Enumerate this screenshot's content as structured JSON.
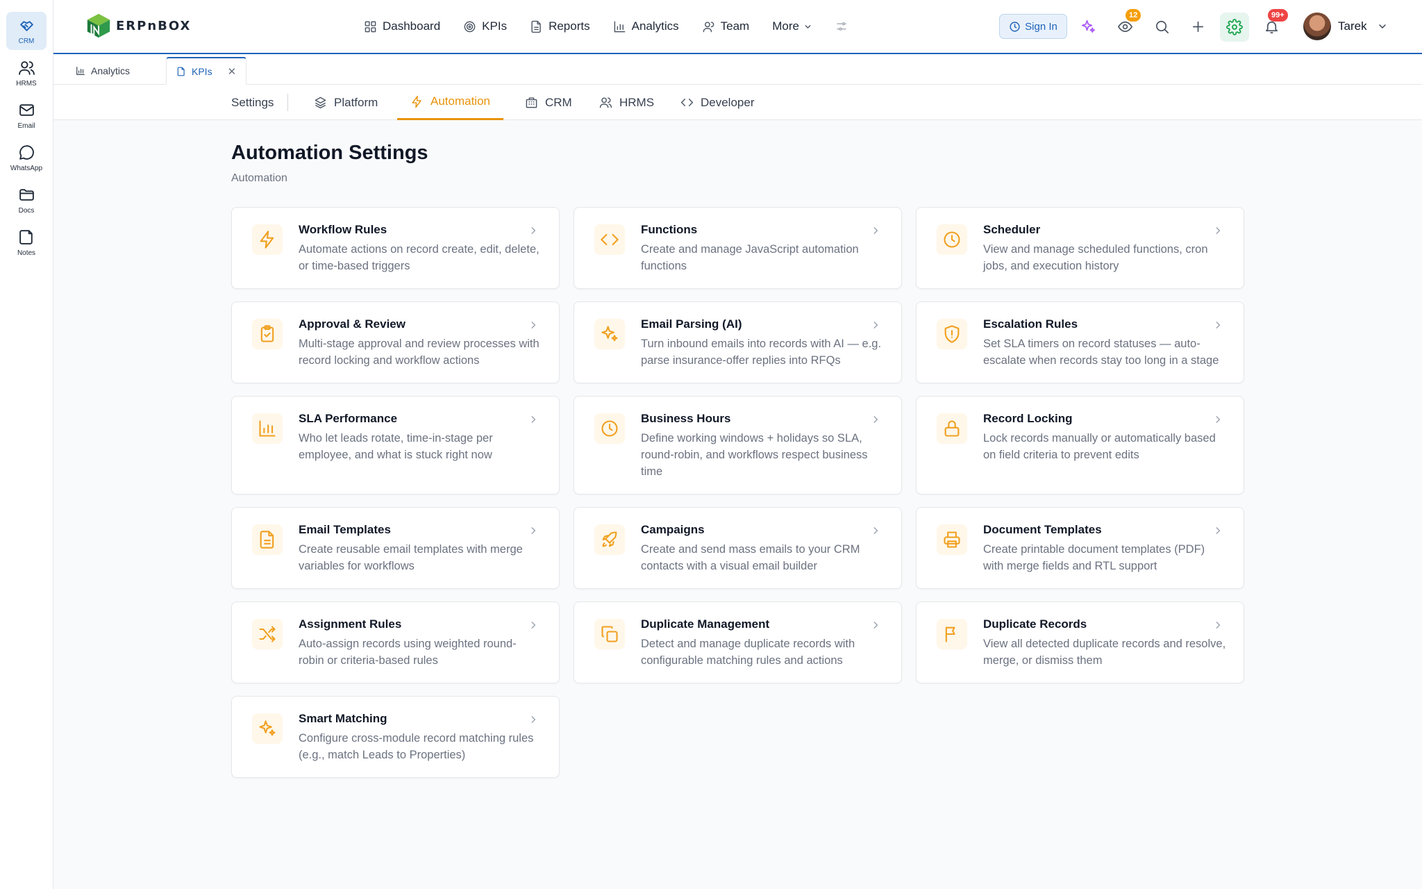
{
  "rail": [
    {
      "label": "CRM",
      "icon": "handshake-icon",
      "active": true
    },
    {
      "label": "HRMS",
      "icon": "users-icon"
    },
    {
      "label": "Email",
      "icon": "mail-icon"
    },
    {
      "label": "WhatsApp",
      "icon": "chat-icon"
    },
    {
      "label": "Docs",
      "icon": "folder-icon"
    },
    {
      "label": "Notes",
      "icon": "note-icon"
    }
  ],
  "brand": {
    "name": "ERPnBOX"
  },
  "nav": {
    "dashboard": "Dashboard",
    "kpis": "KPIs",
    "reports": "Reports",
    "analytics": "Analytics",
    "team": "Team",
    "more": "More"
  },
  "header": {
    "sign_in": "Sign In",
    "watch_badge": "12",
    "notif_badge": "99+",
    "user_name": "Tarek"
  },
  "page_tabs": [
    {
      "label": "Analytics",
      "icon": "bar-chart-icon"
    },
    {
      "label": "KPIs",
      "icon": "file-icon",
      "active": true
    }
  ],
  "subnav": {
    "settings": "Settings",
    "tabs": [
      {
        "label": "Platform",
        "icon": "layers-icon"
      },
      {
        "label": "Automation",
        "icon": "bolt-icon",
        "active": true
      },
      {
        "label": "CRM",
        "icon": "building-icon"
      },
      {
        "label": "HRMS",
        "icon": "users-icon"
      },
      {
        "label": "Developer",
        "icon": "code-icon"
      }
    ]
  },
  "page": {
    "title": "Automation Settings",
    "subtitle": "Automation"
  },
  "cards": [
    {
      "title": "Workflow Rules",
      "desc": "Automate actions on record create, edit, delete, or time-based triggers",
      "icon": "bolt-icon"
    },
    {
      "title": "Functions",
      "desc": "Create and manage JavaScript automation functions",
      "icon": "code-icon"
    },
    {
      "title": "Scheduler",
      "desc": "View and manage scheduled functions, cron jobs, and execution history",
      "icon": "clock-icon"
    },
    {
      "title": "Approval & Review",
      "desc": "Multi-stage approval and review processes with record locking and workflow actions",
      "icon": "clipboard-check-icon"
    },
    {
      "title": "Email Parsing (AI)",
      "desc": "Turn inbound emails into records with AI — e.g. parse insurance-offer replies into RFQs",
      "icon": "sparkles-icon"
    },
    {
      "title": "Escalation Rules",
      "desc": "Set SLA timers on record statuses — auto-escalate when records stay too long in a stage",
      "icon": "shield-alert-icon"
    },
    {
      "title": "SLA Performance",
      "desc": "Who let leads rotate, time-in-stage per employee, and what is stuck right now",
      "icon": "bar-chart-icon"
    },
    {
      "title": "Business Hours",
      "desc": "Define working windows + holidays so SLA, round-robin, and workflows respect business time",
      "icon": "clock-icon"
    },
    {
      "title": "Record Locking",
      "desc": "Lock records manually or automatically based on field criteria to prevent edits",
      "icon": "lock-icon"
    },
    {
      "title": "Email Templates",
      "desc": "Create reusable email templates with merge variables for workflows",
      "icon": "file-text-icon"
    },
    {
      "title": "Campaigns",
      "desc": "Create and send mass emails to your CRM contacts with a visual email builder",
      "icon": "rocket-icon"
    },
    {
      "title": "Document Templates",
      "desc": "Create printable document templates (PDF) with merge fields and RTL support",
      "icon": "printer-icon"
    },
    {
      "title": "Assignment Rules",
      "desc": "Auto-assign records using weighted round-robin or criteria-based rules",
      "icon": "shuffle-icon"
    },
    {
      "title": "Duplicate Management",
      "desc": "Detect and manage duplicate records with configurable matching rules and actions",
      "icon": "copy-icon"
    },
    {
      "title": "Duplicate Records",
      "desc": "View all detected duplicate records and resolve, merge, or dismiss them",
      "icon": "flag-icon"
    },
    {
      "title": "Smart Matching",
      "desc": "Configure cross-module record matching rules (e.g., match Leads to Properties)",
      "icon": "sparkles-icon"
    }
  ],
  "colors": {
    "accent": "#e8930a",
    "primary": "#1e63b8",
    "icon": "#f0a020"
  }
}
